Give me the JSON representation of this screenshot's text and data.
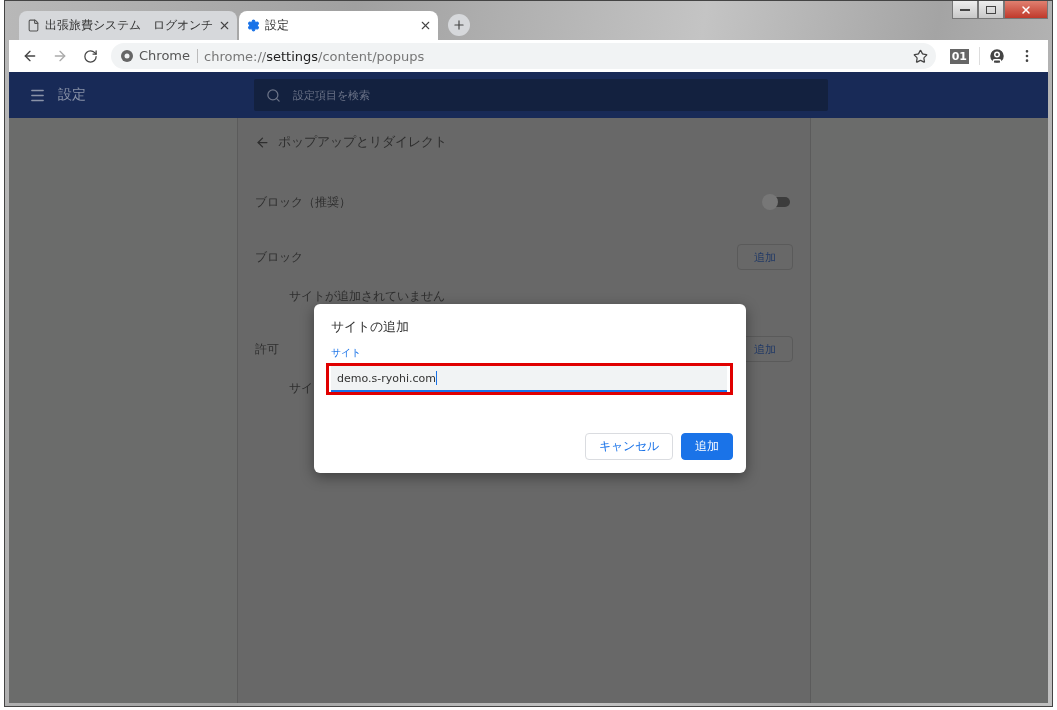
{
  "tabs": [
    {
      "label": "出張旅費システム　ログオンチ",
      "selected": false
    },
    {
      "label": "設定",
      "selected": true
    }
  ],
  "toolbar": {
    "site_label": "Chrome",
    "url": {
      "prefix": "chrome://",
      "host": "settings",
      "path": "/content/popups"
    },
    "extension_badge": "01"
  },
  "header": {
    "title": "設定",
    "search_placeholder": "設定項目を検索"
  },
  "page": {
    "title": "ポップアップとリダイレクト",
    "toggle_row": {
      "label": "ブロック（推奨）",
      "on": false
    },
    "sections": [
      {
        "label": "ブロック",
        "button": "追加",
        "empty_text": "サイトが追加されていません"
      },
      {
        "label": "許可",
        "button": "追加",
        "empty_text": "サイ"
      }
    ]
  },
  "dialog": {
    "title": "サイトの追加",
    "field": {
      "label": "サイト",
      "value": "demo.s-ryohi.com",
      "focused": true
    },
    "highlighted": true,
    "buttons": [
      {
        "label": "キャンセル",
        "kind": "secondary"
      },
      {
        "label": "追加",
        "kind": "primary"
      }
    ]
  }
}
